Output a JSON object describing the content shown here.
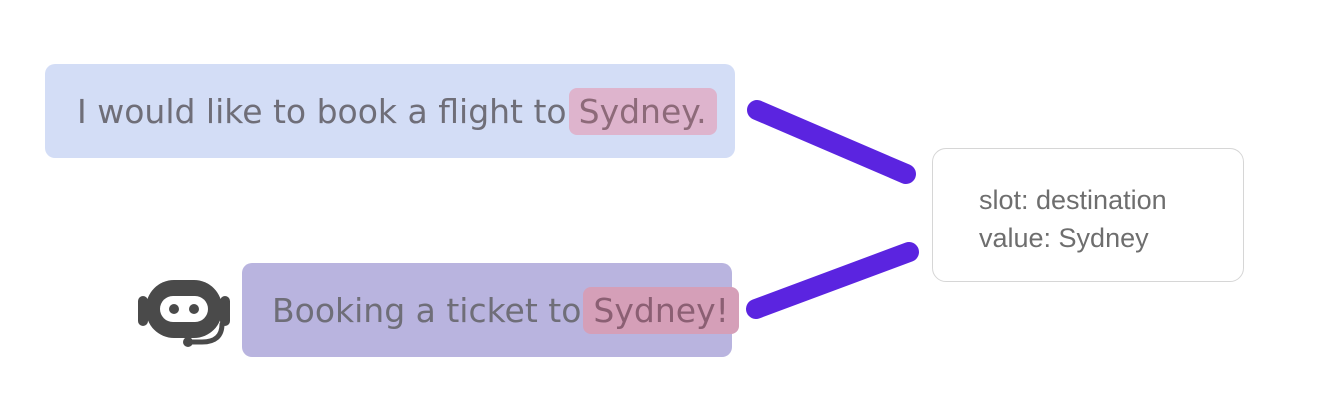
{
  "user_message": {
    "text_before": "I would like to book a flight to",
    "highlight": "Sydney."
  },
  "bot_message": {
    "text_before": "Booking a ticket to",
    "highlight": "Sydney!"
  },
  "slot_box": {
    "slot_line": "slot: destination",
    "value_line": "value: Sydney"
  },
  "colors": {
    "user_bubble": "#d3ddf6",
    "bot_bubble": "#b9b4df",
    "highlight": "#deb4cd",
    "connector": "#5b24e0"
  },
  "icons": {
    "bot": "bot-headset-icon"
  }
}
